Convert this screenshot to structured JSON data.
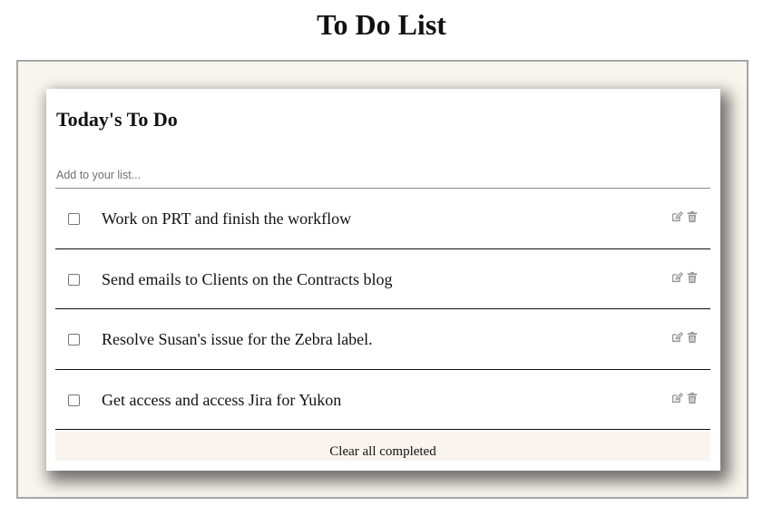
{
  "page": {
    "title": "To Do List"
  },
  "card": {
    "title": "Today's To Do",
    "input": {
      "placeholder": "Add to your list...",
      "value": ""
    },
    "items": [
      {
        "text": "Work on PRT and finish the workflow",
        "checked": false
      },
      {
        "text": "Send emails to Clients on the Contracts blog",
        "checked": false
      },
      {
        "text": "Resolve Susan's issue for the Zebra label.",
        "checked": false
      },
      {
        "text": "Get access and access Jira for Yukon",
        "checked": false
      }
    ],
    "footer": {
      "clear_label": "Clear all completed"
    },
    "icons": {
      "edit": "edit-icon",
      "delete": "trash-icon"
    }
  },
  "colors": {
    "frame_bg": "#f8f4ee",
    "icon": "#9a9a9a",
    "footer_bg": "#f9f4ee"
  }
}
